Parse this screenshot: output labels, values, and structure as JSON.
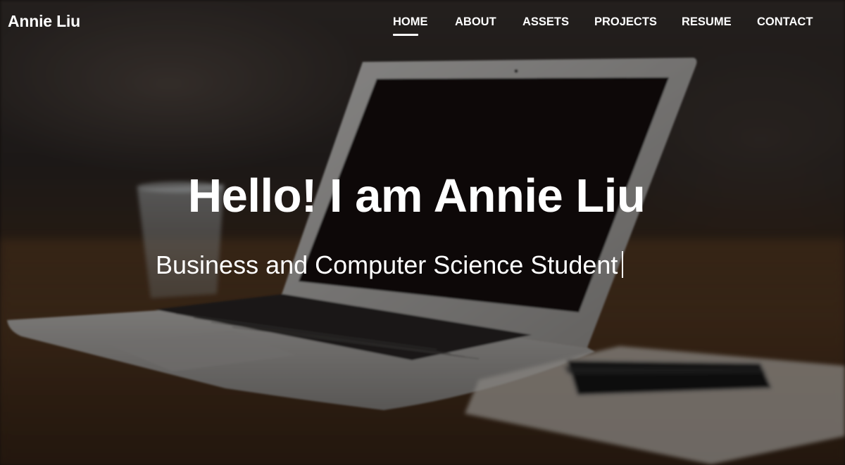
{
  "brand": {
    "name": "Annie Liu"
  },
  "nav": {
    "items": [
      {
        "label": "HOME",
        "active": true
      },
      {
        "label": "ABOUT",
        "active": false
      },
      {
        "label": "ASSETS",
        "active": false
      },
      {
        "label": "PROJECTS",
        "active": false
      },
      {
        "label": "RESUME",
        "active": false
      },
      {
        "label": "CONTACT",
        "active": false
      }
    ]
  },
  "hero": {
    "headline": "Hello! I am Annie Liu",
    "subline": "Business and Computer Science Student",
    "background_icon": "laptop-on-desk-photo"
  },
  "colors": {
    "text": "#ffffff",
    "overlay": "#000000",
    "table_wood": "#5a3a20",
    "laptop_silver": "#b9b6b3"
  }
}
